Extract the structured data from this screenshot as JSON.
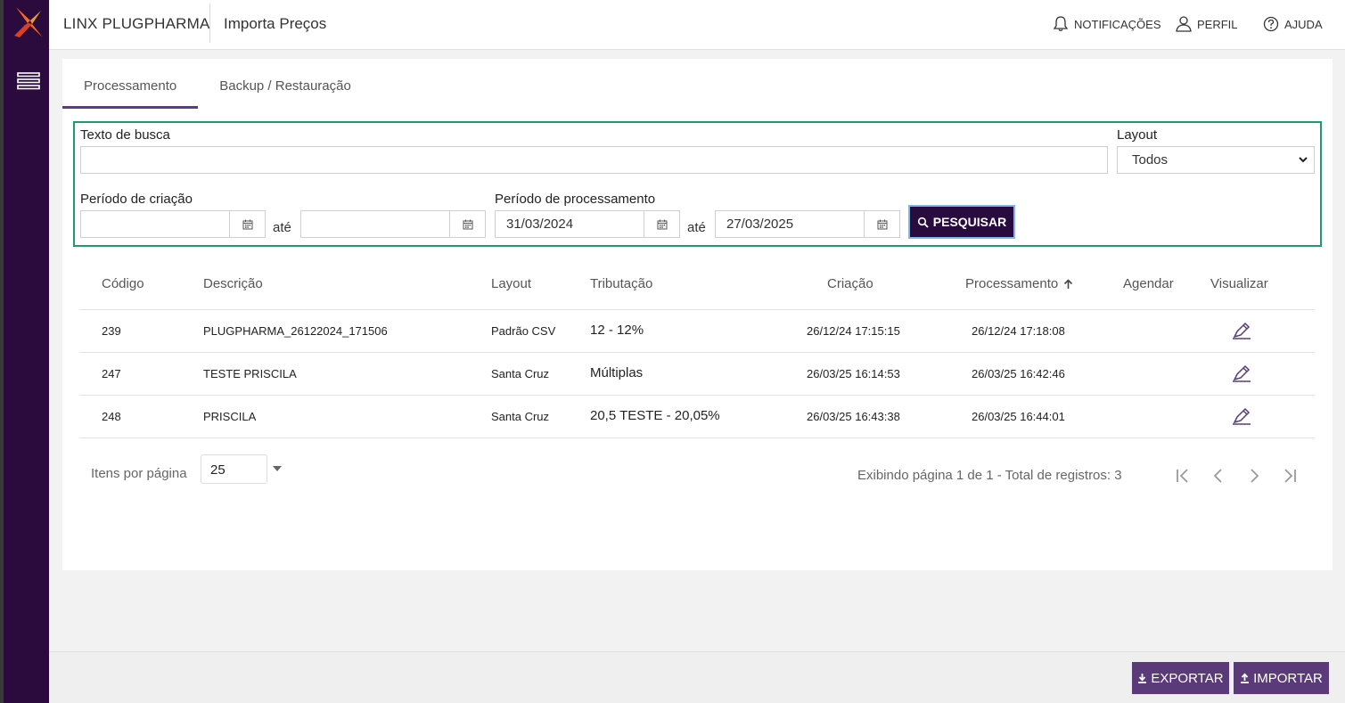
{
  "header": {
    "brand": "LINX PLUGPHARMA",
    "page_title": "Importa Preços",
    "notifications": "NOTIFICAÇÕES",
    "profile": "PERFIL",
    "help": "AJUDA"
  },
  "tabs": [
    {
      "label": "Processamento",
      "active": true
    },
    {
      "label": "Backup / Restauração",
      "active": false
    }
  ],
  "filters": {
    "search_label": "Texto de busca",
    "search_value": "",
    "layout_label": "Layout",
    "layout_value": "Todos",
    "creation_label": "Período de criação",
    "creation_from": "",
    "creation_to": "",
    "between": "até",
    "processing_label": "Período de processamento",
    "processing_from": "31/03/2024",
    "processing_to": "27/03/2025",
    "search_button": "PESQUISAR"
  },
  "table": {
    "columns": [
      "Código",
      "Descrição",
      "Layout",
      "Tributação",
      "Criação",
      "Processamento",
      "Agendar",
      "Visualizar"
    ],
    "rows": [
      {
        "codigo": "239",
        "descricao": "PLUGPHARMA_26122024_171506",
        "layout": "Padrão CSV",
        "tributacao": "12 - 12%",
        "criacao": "26/12/24 17:15:15",
        "processamento": "26/12/24 17:18:08"
      },
      {
        "codigo": "247",
        "descricao": "TESTE PRISCILA",
        "layout": "Santa Cruz",
        "tributacao": "Múltiplas",
        "criacao": "26/03/25 16:14:53",
        "processamento": "26/03/25 16:42:46"
      },
      {
        "codigo": "248",
        "descricao": "PRISCILA",
        "layout": "Santa Cruz",
        "tributacao": "20,5 TESTE - 20,05%",
        "criacao": "26/03/25 16:43:38",
        "processamento": "26/03/25 16:44:01"
      }
    ]
  },
  "pagination": {
    "items_per_page_label": "Itens por página",
    "items_per_page": "25",
    "info": "Exibindo página 1 de 1 - Total de registros: 3"
  },
  "footer": {
    "export": "EXPORTAR",
    "import": "IMPORTAR"
  },
  "colors": {
    "sidebar": "#2b0a3d",
    "accent": "#5a3a78",
    "filter_border": "#1f9a6d"
  }
}
